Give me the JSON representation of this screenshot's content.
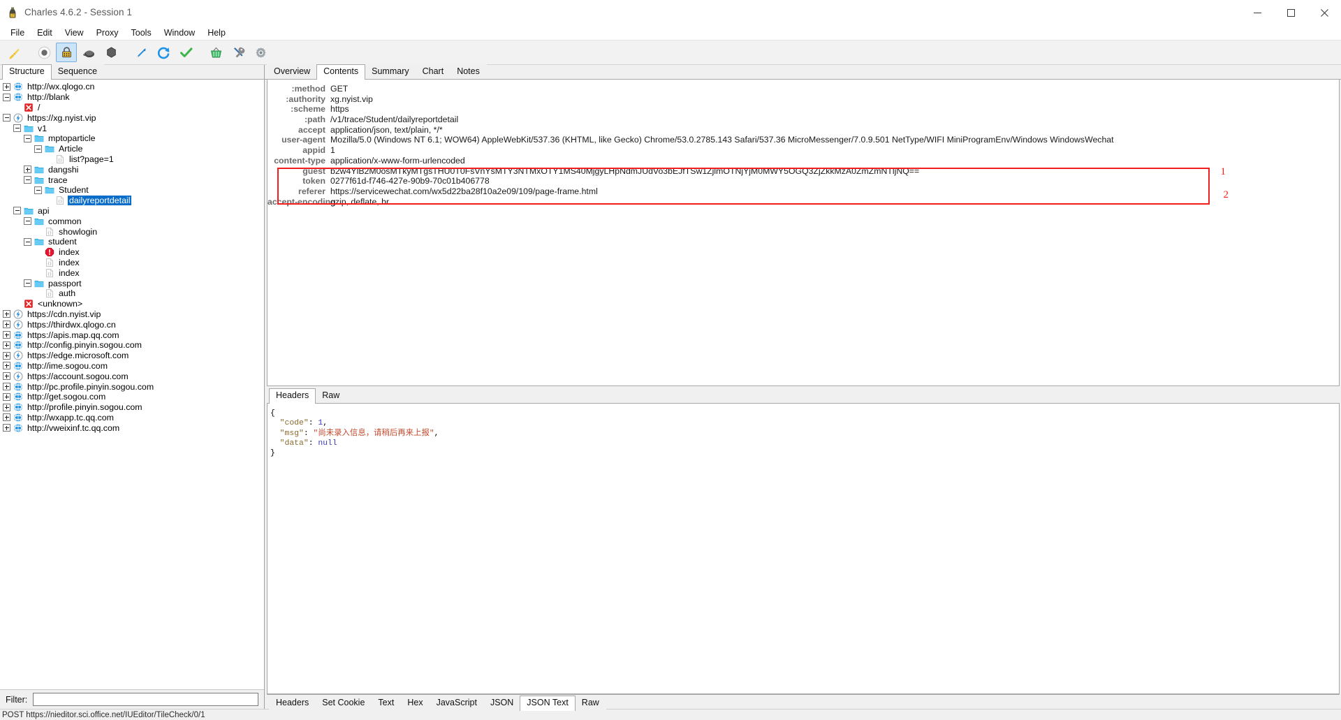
{
  "window": {
    "title": "Charles 4.6.2 - Session 1",
    "app_icon": "charles-bottle-icon",
    "minimize_label": "─",
    "maximize_label": "☐",
    "close_label": "✕"
  },
  "menubar": {
    "items": [
      "File",
      "Edit",
      "View",
      "Proxy",
      "Tools",
      "Window",
      "Help"
    ]
  },
  "toolbar": {
    "buttons": [
      {
        "name": "clear-session-icon",
        "tip": "Clear the current session"
      },
      {
        "name": "record-icon",
        "tip": "Start/Stop Recording"
      },
      {
        "name": "ssl-proxying-icon",
        "tip": "SSL Proxying",
        "active": true
      },
      {
        "name": "throttling-icon",
        "tip": "Start/Stop Throttling"
      },
      {
        "name": "breakpoints-icon",
        "tip": "Enable/Disable Breakpoints"
      },
      {
        "name": "compose-icon",
        "tip": "Compose a new request"
      },
      {
        "name": "repeat-icon",
        "tip": "Repeat the request"
      },
      {
        "name": "validate-icon",
        "tip": "Validate the recording"
      },
      {
        "name": "tools-basket-icon",
        "tip": "Tools"
      },
      {
        "name": "settings-wrench-icon",
        "tip": "Settings"
      },
      {
        "name": "preferences-gear-icon",
        "tip": "Preferences"
      }
    ]
  },
  "left": {
    "tabs": [
      {
        "label": "Structure",
        "selected": true
      },
      {
        "label": "Sequence",
        "selected": false
      }
    ],
    "filter_label": "Filter:",
    "filter_value": "",
    "filter_placeholder": "",
    "tree": [
      {
        "depth": 0,
        "label": "http://wx.qlogo.cn",
        "toggle": "plus",
        "icon": "globe-icon"
      },
      {
        "depth": 0,
        "label": "http://blank",
        "toggle": "minus",
        "icon": "globe-icon"
      },
      {
        "depth": 1,
        "label": "/",
        "toggle": "none",
        "icon": "error-icon"
      },
      {
        "depth": 0,
        "label": "https://xg.nyist.vip",
        "toggle": "minus",
        "icon": "ssl-icon"
      },
      {
        "depth": 1,
        "label": "v1",
        "toggle": "minus",
        "icon": "folder-icon"
      },
      {
        "depth": 2,
        "label": "mptoparticle",
        "toggle": "minus",
        "icon": "folder-icon"
      },
      {
        "depth": 3,
        "label": "Article",
        "toggle": "minus",
        "icon": "folder-icon"
      },
      {
        "depth": 4,
        "label": "list?page=1",
        "toggle": "none",
        "icon": "json-doc-icon"
      },
      {
        "depth": 2,
        "label": "dangshi",
        "toggle": "plus",
        "icon": "folder-icon"
      },
      {
        "depth": 2,
        "label": "trace",
        "toggle": "minus",
        "icon": "folder-icon"
      },
      {
        "depth": 3,
        "label": "Student",
        "toggle": "minus",
        "icon": "folder-icon"
      },
      {
        "depth": 4,
        "label": "dailyreportdetail",
        "toggle": "none",
        "icon": "json-doc-icon",
        "selected": true
      },
      {
        "depth": 1,
        "label": "api",
        "toggle": "minus",
        "icon": "folder-icon"
      },
      {
        "depth": 2,
        "label": "common",
        "toggle": "minus",
        "icon": "folder-icon"
      },
      {
        "depth": 3,
        "label": "showlogin",
        "toggle": "none",
        "icon": "json-doc-icon"
      },
      {
        "depth": 2,
        "label": "student",
        "toggle": "minus",
        "icon": "folder-icon"
      },
      {
        "depth": 3,
        "label": "index",
        "toggle": "none",
        "icon": "blocked-icon"
      },
      {
        "depth": 3,
        "label": "index",
        "toggle": "none",
        "icon": "json-doc-icon"
      },
      {
        "depth": 3,
        "label": "index",
        "toggle": "none",
        "icon": "json-doc-icon"
      },
      {
        "depth": 2,
        "label": "passport",
        "toggle": "minus",
        "icon": "folder-icon"
      },
      {
        "depth": 3,
        "label": "auth",
        "toggle": "none",
        "icon": "json-doc-icon"
      },
      {
        "depth": 1,
        "label": "<unknown>",
        "toggle": "none",
        "icon": "error-icon"
      },
      {
        "depth": 0,
        "label": "https://cdn.nyist.vip",
        "toggle": "plus",
        "icon": "ssl-icon"
      },
      {
        "depth": 0,
        "label": "https://thirdwx.qlogo.cn",
        "toggle": "plus",
        "icon": "ssl-icon"
      },
      {
        "depth": 0,
        "label": "https://apis.map.qq.com",
        "toggle": "plus",
        "icon": "globe-icon"
      },
      {
        "depth": 0,
        "label": "http://config.pinyin.sogou.com",
        "toggle": "plus",
        "icon": "globe-icon"
      },
      {
        "depth": 0,
        "label": "https://edge.microsoft.com",
        "toggle": "plus",
        "icon": "ssl-icon"
      },
      {
        "depth": 0,
        "label": "http://ime.sogou.com",
        "toggle": "plus",
        "icon": "globe-icon"
      },
      {
        "depth": 0,
        "label": "https://account.sogou.com",
        "toggle": "plus",
        "icon": "ssl-icon"
      },
      {
        "depth": 0,
        "label": "http://pc.profile.pinyin.sogou.com",
        "toggle": "plus",
        "icon": "globe-icon"
      },
      {
        "depth": 0,
        "label": "http://get.sogou.com",
        "toggle": "plus",
        "icon": "globe-icon"
      },
      {
        "depth": 0,
        "label": "http://profile.pinyin.sogou.com",
        "toggle": "plus",
        "icon": "globe-icon"
      },
      {
        "depth": 0,
        "label": "http://wxapp.tc.qq.com",
        "toggle": "plus",
        "icon": "globe-icon"
      },
      {
        "depth": 0,
        "label": "http://vweixinf.tc.qq.com",
        "toggle": "plus",
        "icon": "globe-icon"
      }
    ]
  },
  "right": {
    "top_tabs": [
      {
        "label": "Overview",
        "selected": false
      },
      {
        "label": "Contents",
        "selected": true
      },
      {
        "label": "Summary",
        "selected": false
      },
      {
        "label": "Chart",
        "selected": false
      },
      {
        "label": "Notes",
        "selected": false
      }
    ],
    "request_tabs": [
      {
        "label": "Headers",
        "selected": true
      },
      {
        "label": "Raw",
        "selected": false
      }
    ],
    "response_tabs": [
      {
        "label": "Headers",
        "selected": false
      },
      {
        "label": "Set Cookie",
        "selected": false
      },
      {
        "label": "Text",
        "selected": false
      },
      {
        "label": "Hex",
        "selected": false
      },
      {
        "label": "JavaScript",
        "selected": false
      },
      {
        "label": "JSON",
        "selected": false
      },
      {
        "label": "JSON Text",
        "selected": true
      },
      {
        "label": "Raw",
        "selected": false
      }
    ],
    "headers": [
      {
        "name": ":method",
        "value": "GET"
      },
      {
        "name": ":authority",
        "value": "xg.nyist.vip"
      },
      {
        "name": ":scheme",
        "value": "https"
      },
      {
        "name": ":path",
        "value": "/v1/trace/Student/dailyreportdetail"
      },
      {
        "name": "accept",
        "value": "application/json, text/plain, */*"
      },
      {
        "name": "user-agent",
        "value": "Mozilla/5.0 (Windows NT 6.1; WOW64) AppleWebKit/537.36 (KHTML, like Gecko) Chrome/53.0.2785.143 Safari/537.36 MicroMessenger/7.0.9.501 NetType/WIFI MiniProgramEnv/Windows WindowsWechat"
      },
      {
        "name": "appid",
        "value": "1"
      },
      {
        "name": "content-type",
        "value": "application/x-www-form-urlencoded"
      },
      {
        "name": "guest",
        "value": "b2w4YlB2M0osMTkyMTgsTHU0T0FsVnYsMTY3NTMxOTY1MS40MjgyLHpNdmJUdVo3bEJfTSw1ZjlmOTNjYjM0MWY5OGQ3ZjZkkMzA0ZmZmNTljNQ=="
      },
      {
        "name": "token",
        "value": "0277f61d-f746-427e-90b9-70c01b406778"
      },
      {
        "name": "referer",
        "value": "https://servicewechat.com/wx5d22ba28f10a2e09/109/page-frame.html"
      },
      {
        "name": "accept-encoding",
        "value": "gzip, deflate, br"
      }
    ],
    "annotations": [
      {
        "label": "1"
      },
      {
        "label": "2"
      }
    ],
    "response_body": {
      "lines": [
        [
          {
            "t": "punc",
            "v": "{"
          }
        ],
        [
          {
            "t": "sp",
            "v": "  "
          },
          {
            "t": "key",
            "v": "\"code\""
          },
          {
            "t": "punc",
            "v": ": "
          },
          {
            "t": "num",
            "v": "1"
          },
          {
            "t": "punc",
            "v": ","
          }
        ],
        [
          {
            "t": "sp",
            "v": "  "
          },
          {
            "t": "key",
            "v": "\"msg\""
          },
          {
            "t": "punc",
            "v": ": "
          },
          {
            "t": "str",
            "v": "\"尚未录入信息，请稍后再来上报\""
          },
          {
            "t": "punc",
            "v": ","
          }
        ],
        [
          {
            "t": "sp",
            "v": "  "
          },
          {
            "t": "key",
            "v": "\"data\""
          },
          {
            "t": "punc",
            "v": ": "
          },
          {
            "t": "null",
            "v": "null"
          }
        ],
        [
          {
            "t": "punc",
            "v": "}"
          }
        ]
      ]
    }
  },
  "statusbar": {
    "text": "POST https://nieditor.sci.office.net/IUEditor/TileCheck/0/1"
  },
  "colors": {
    "accent_selection": "#0a6dc9",
    "annotation_red": "#f41d1d",
    "folder_blue": "#4fc3f0",
    "error_red": "#e02020",
    "toolbar_bg": "#f2f2f2"
  }
}
